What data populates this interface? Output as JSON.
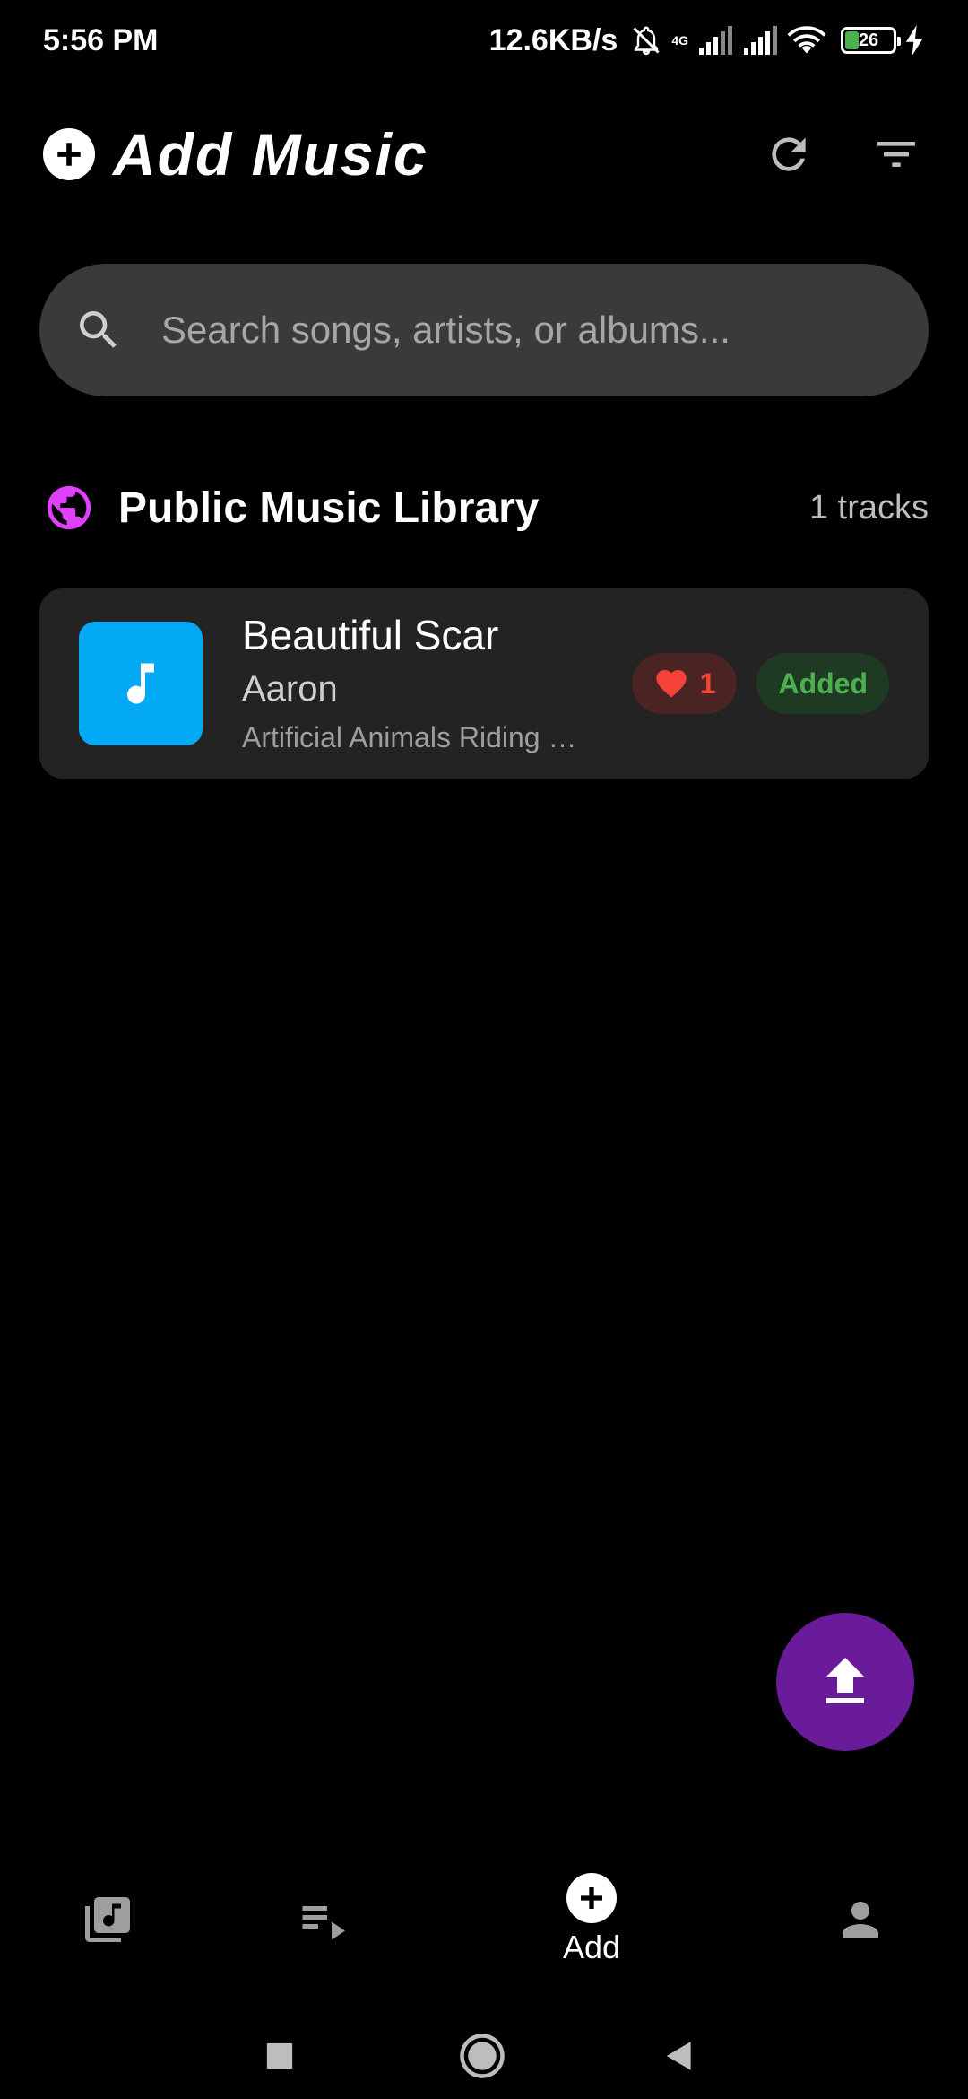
{
  "status_bar": {
    "time": "5:56 PM",
    "net_speed": "12.6KB/s",
    "network_type": "4G",
    "battery_level": "26",
    "icons": [
      "mute-icon",
      "signal-icon",
      "signal-icon",
      "wifi-icon",
      "battery-icon",
      "charging-icon"
    ]
  },
  "header": {
    "title": "Add Music",
    "title_icon": "add-circle-icon",
    "actions": [
      "refresh-icon",
      "filter-icon"
    ]
  },
  "search": {
    "placeholder": "Search songs, artists, or albums..."
  },
  "library": {
    "title": "Public Music Library",
    "count_text": "1 tracks",
    "icon": "globe-icon",
    "icon_color": "#e040fb"
  },
  "tracks": [
    {
      "title": "Beautiful Scar",
      "artist": "Aaron",
      "album": "Artificial Animals Riding on Neverland",
      "likes": "1",
      "status": "Added",
      "art_color": "#03a9f4"
    }
  ],
  "fab": {
    "icon": "upload-icon",
    "color": "#6a1b9a"
  },
  "bottom_nav": {
    "items": [
      {
        "icon": "library-music-icon",
        "label": ""
      },
      {
        "icon": "queue-play-icon",
        "label": ""
      },
      {
        "icon": "add-circle-icon",
        "label": "Add"
      },
      {
        "icon": "person-icon",
        "label": ""
      }
    ],
    "active_index": 2
  },
  "colors": {
    "background": "#000000",
    "surface": "#232323",
    "search_bg": "#3a3a3a",
    "accent_purple": "#6a1b9a",
    "like_red": "#f44336",
    "added_green": "#4caf50"
  }
}
